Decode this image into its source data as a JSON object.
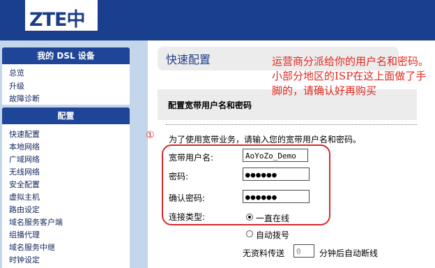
{
  "header": {
    "logo_text": "ZTE中兴"
  },
  "sidebar": {
    "sections": [
      {
        "title": "我的 DSL 设备",
        "items": [
          "总览",
          "升级",
          "故障诊断"
        ]
      },
      {
        "title": "配置",
        "items": [
          "快速配置",
          "本地网络",
          "广域网络",
          "无线网络",
          "安全配置",
          "虚拟主机",
          "路由设定",
          "域名服务客户端",
          "组播代理",
          "域名服务中继",
          "时钟设定"
        ]
      }
    ]
  },
  "main": {
    "title": "快速配置",
    "section_title": "配置宽带用户名和密码",
    "intro": "为了使用宽带业务，请输入您的宽带用户名和密码。",
    "marker": "①",
    "fields": {
      "username": {
        "label": "宽带用户名:",
        "value": "AoYoZo_Demo"
      },
      "password": {
        "label": "密码:",
        "value": "●●●●●●"
      },
      "confirm": {
        "label": "确认密码:",
        "value": "●●●●●●"
      },
      "conn_type": {
        "label": "连接类型:"
      }
    },
    "conn_options": [
      {
        "label": "一直在线",
        "selected": true
      },
      {
        "label": "自动拨号",
        "selected": false
      }
    ],
    "idle": {
      "prefix": "无资料传送",
      "value": "0",
      "suffix": "分钟后自动断线"
    }
  },
  "annotation": {
    "text": "运营商分派给你的用户名和密码。小部分地区的ISP在这上面做了手脚的，请确认好再购买",
    "color": "#e2271e"
  },
  "colors": {
    "nav_header": "#1f4599",
    "sidebar_bg": "#c4d6ec",
    "topbar": "#1b3f8f"
  }
}
